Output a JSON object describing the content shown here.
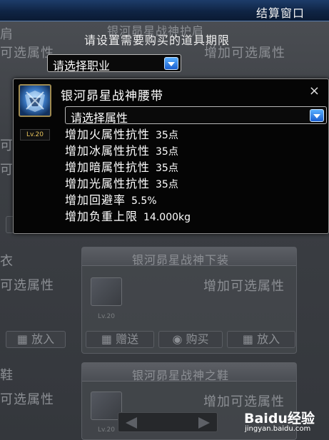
{
  "window": {
    "title": "结算窗口"
  },
  "instruction": "请设置需要购买的道具期限",
  "job_select": {
    "value": "请选择职业"
  },
  "popup": {
    "item_name": "银河昴星战神腰带",
    "level_badge": "Lv.20",
    "close_glyph": "×",
    "attr_select": {
      "value": "请选择属性"
    },
    "options": [
      {
        "label": "增加火属性抗性",
        "value": "35点"
      },
      {
        "label": "增加冰属性抗性",
        "value": "35点"
      },
      {
        "label": "增加暗属性抗性",
        "value": "35点"
      },
      {
        "label": "增加光属性抗性",
        "value": "35点"
      },
      {
        "label": "增加回避率",
        "value": "5.5%"
      },
      {
        "label": "增加负重上限",
        "value": "14.000kg"
      }
    ]
  },
  "background": {
    "left_labels": [
      "肩",
      "可选属性",
      "可选属性",
      "可选属性",
      "衣",
      "可选属性",
      "鞋",
      "可选属性"
    ],
    "top_faded": "银河昴星战神护肩",
    "right_top_label": "增加可选属性",
    "put_label": "放入",
    "put_label_right": "放入",
    "panel1": {
      "title": "银河昴星战神下装",
      "attr_label": "增加可选属性",
      "level": "Lv.20"
    },
    "panel2": {
      "title": "银河昴星战神之鞋",
      "attr_label": "增加可选属性",
      "level": "Lv.20"
    },
    "buttons": {
      "gift": "赠送",
      "buy": "购买",
      "put": "放入"
    }
  },
  "watermark": {
    "brand": "Baidu经验",
    "url": "jingyan.baidu.com"
  },
  "colors": {
    "title_bar": "#0f2444",
    "dropdown_accent": "#1a5fd0",
    "popup_bg": "#050505"
  }
}
